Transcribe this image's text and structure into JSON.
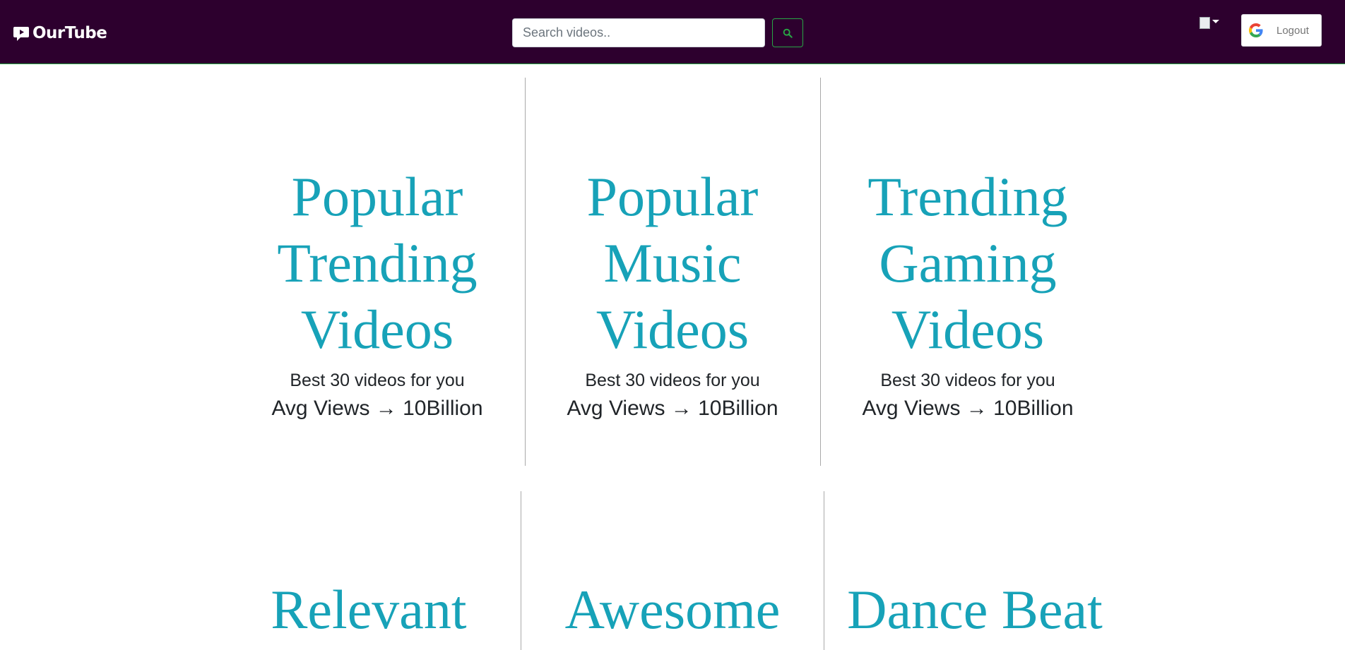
{
  "navbar": {
    "brand": "OurTube",
    "search": {
      "placeholder": "Search videos..",
      "value": ""
    },
    "logout_label": "Logout"
  },
  "cards": [
    {
      "title": [
        "Popular",
        "Trending",
        "Videos"
      ],
      "subtitle": "Best 30 videos for you",
      "views": "Avg Views → 10Billion"
    },
    {
      "title": [
        "Popular",
        "Music",
        "Videos"
      ],
      "subtitle": "Best 30 videos for you",
      "views": "Avg Views → 10Billion"
    },
    {
      "title": [
        "Trending",
        "Gaming",
        "Videos"
      ],
      "subtitle": "Best 30 videos for you",
      "views": "Avg Views → 10Billion"
    },
    {
      "title": [
        "Relevant"
      ]
    },
    {
      "title": [
        "Awesome"
      ]
    },
    {
      "title": [
        "Dance Beat"
      ]
    }
  ],
  "icons": {
    "brand": "message-play-icon",
    "search": "search-icon",
    "google": "google-icon",
    "flag": "flag-image",
    "caret": "caret-down-icon"
  },
  "colors": {
    "navbar": "#2d002e",
    "accent_green": "#28a745",
    "title": "#17a2b8",
    "text": "#212529"
  }
}
